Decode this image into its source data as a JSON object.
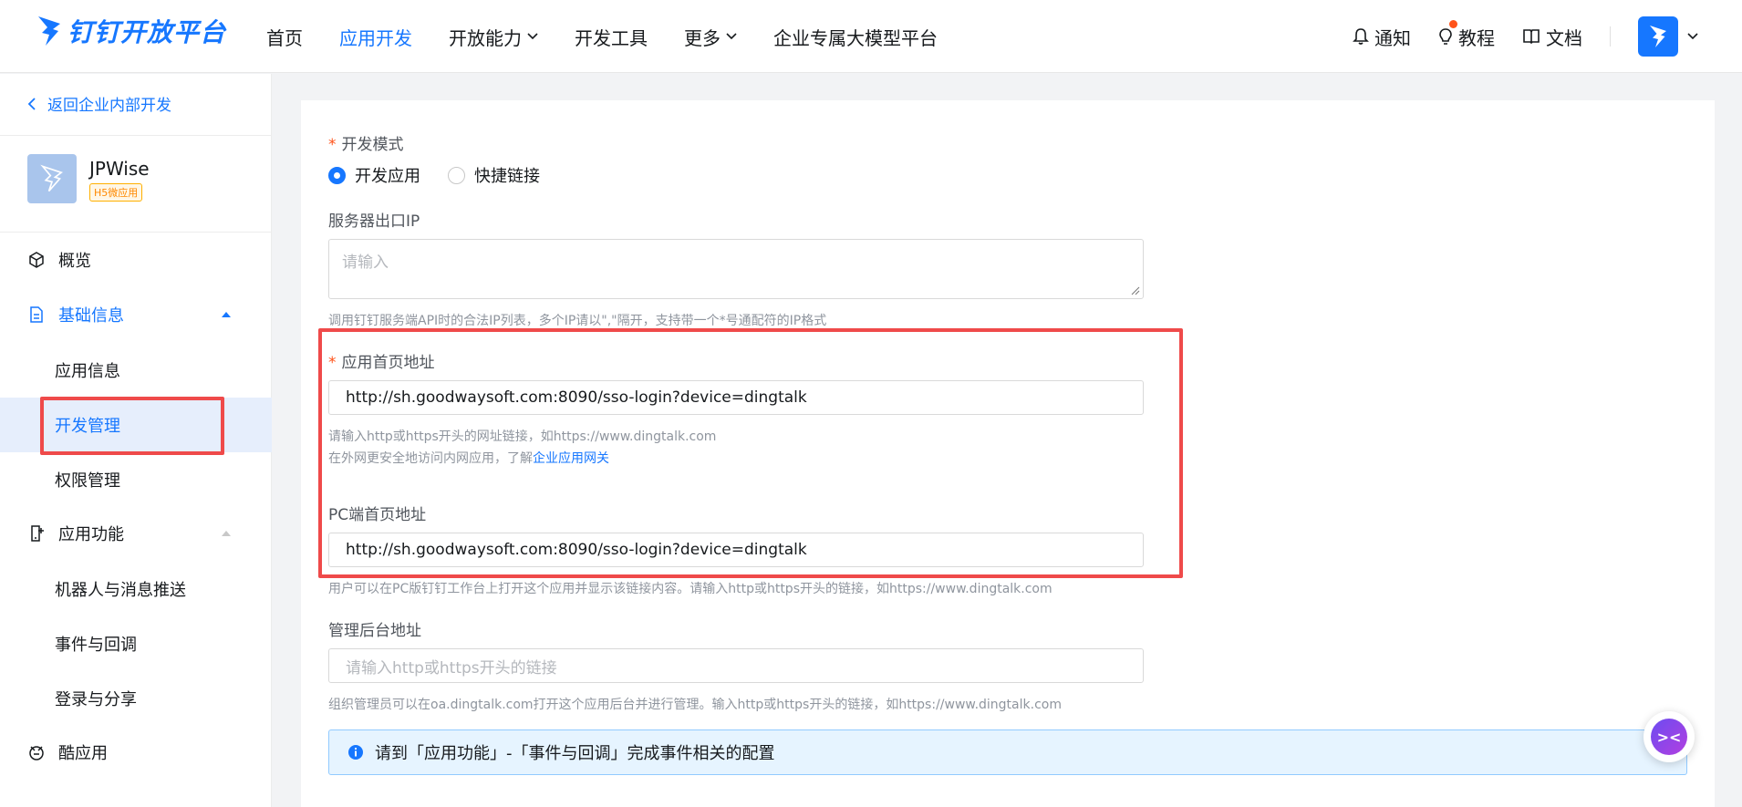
{
  "header": {
    "logo_text": "钉钉开放平台",
    "nav": [
      {
        "label": "首页",
        "has_dropdown": false
      },
      {
        "label": "应用开发",
        "has_dropdown": false,
        "active": true
      },
      {
        "label": "开放能力",
        "has_dropdown": true
      },
      {
        "label": "开发工具",
        "has_dropdown": false
      },
      {
        "label": "更多",
        "has_dropdown": true
      },
      {
        "label": "企业专属大模型平台",
        "has_dropdown": false
      }
    ],
    "right": {
      "notify": "通知",
      "tutorial": "教程",
      "docs": "文档"
    }
  },
  "sidebar": {
    "back": "返回企业内部开发",
    "app": {
      "name": "JPWise",
      "badge": "H5微应用"
    },
    "menu": {
      "overview": "概览",
      "basic_info": "基础信息",
      "basic_info_items": [
        "应用信息",
        "开发管理",
        "权限管理"
      ],
      "app_features": "应用功能",
      "app_features_items": [
        "机器人与消息推送",
        "事件与回调",
        "登录与分享"
      ],
      "cool_apps": "酷应用"
    }
  },
  "form": {
    "dev_mode": {
      "label": "开发模式",
      "options": [
        "开发应用",
        "快捷链接"
      ],
      "selected": "开发应用"
    },
    "server_ip": {
      "label": "服务器出口IP",
      "placeholder": "请输入",
      "hint": "调用钉钉服务端API时的合法IP列表，多个IP请以\",\"隔开，支持带一个*号通配符的IP格式"
    },
    "home_url": {
      "label": "应用首页地址",
      "value": "http://sh.goodwaysoft.com:8090/sso-login?device=dingtalk",
      "hint1": "请输入http或https开头的网址链接，如https://www.dingtalk.com",
      "hint2_prefix": "在外网更安全地访问内网应用，了解",
      "hint2_link": "企业应用网关"
    },
    "pc_home_url": {
      "label": "PC端首页地址",
      "value": "http://sh.goodwaysoft.com:8090/sso-login?device=dingtalk",
      "hint": "用户可以在PC版钉钉工作台上打开这个应用并显示该链接内容。请输入http或https开头的链接，如https://www.dingtalk.com"
    },
    "admin_url": {
      "label": "管理后台地址",
      "placeholder": "请输入http或https开头的链接",
      "hint": "组织管理员可以在oa.dingtalk.com打开这个应用后台并进行管理。输入http或https开头的链接，如https://www.dingtalk.com"
    },
    "notice": "请到「应用功能」-「事件与回调」完成事件相关的配置"
  },
  "colors": {
    "accent": "#1677ff",
    "highlight": "#ef4a4a",
    "required": "#ff5219"
  }
}
